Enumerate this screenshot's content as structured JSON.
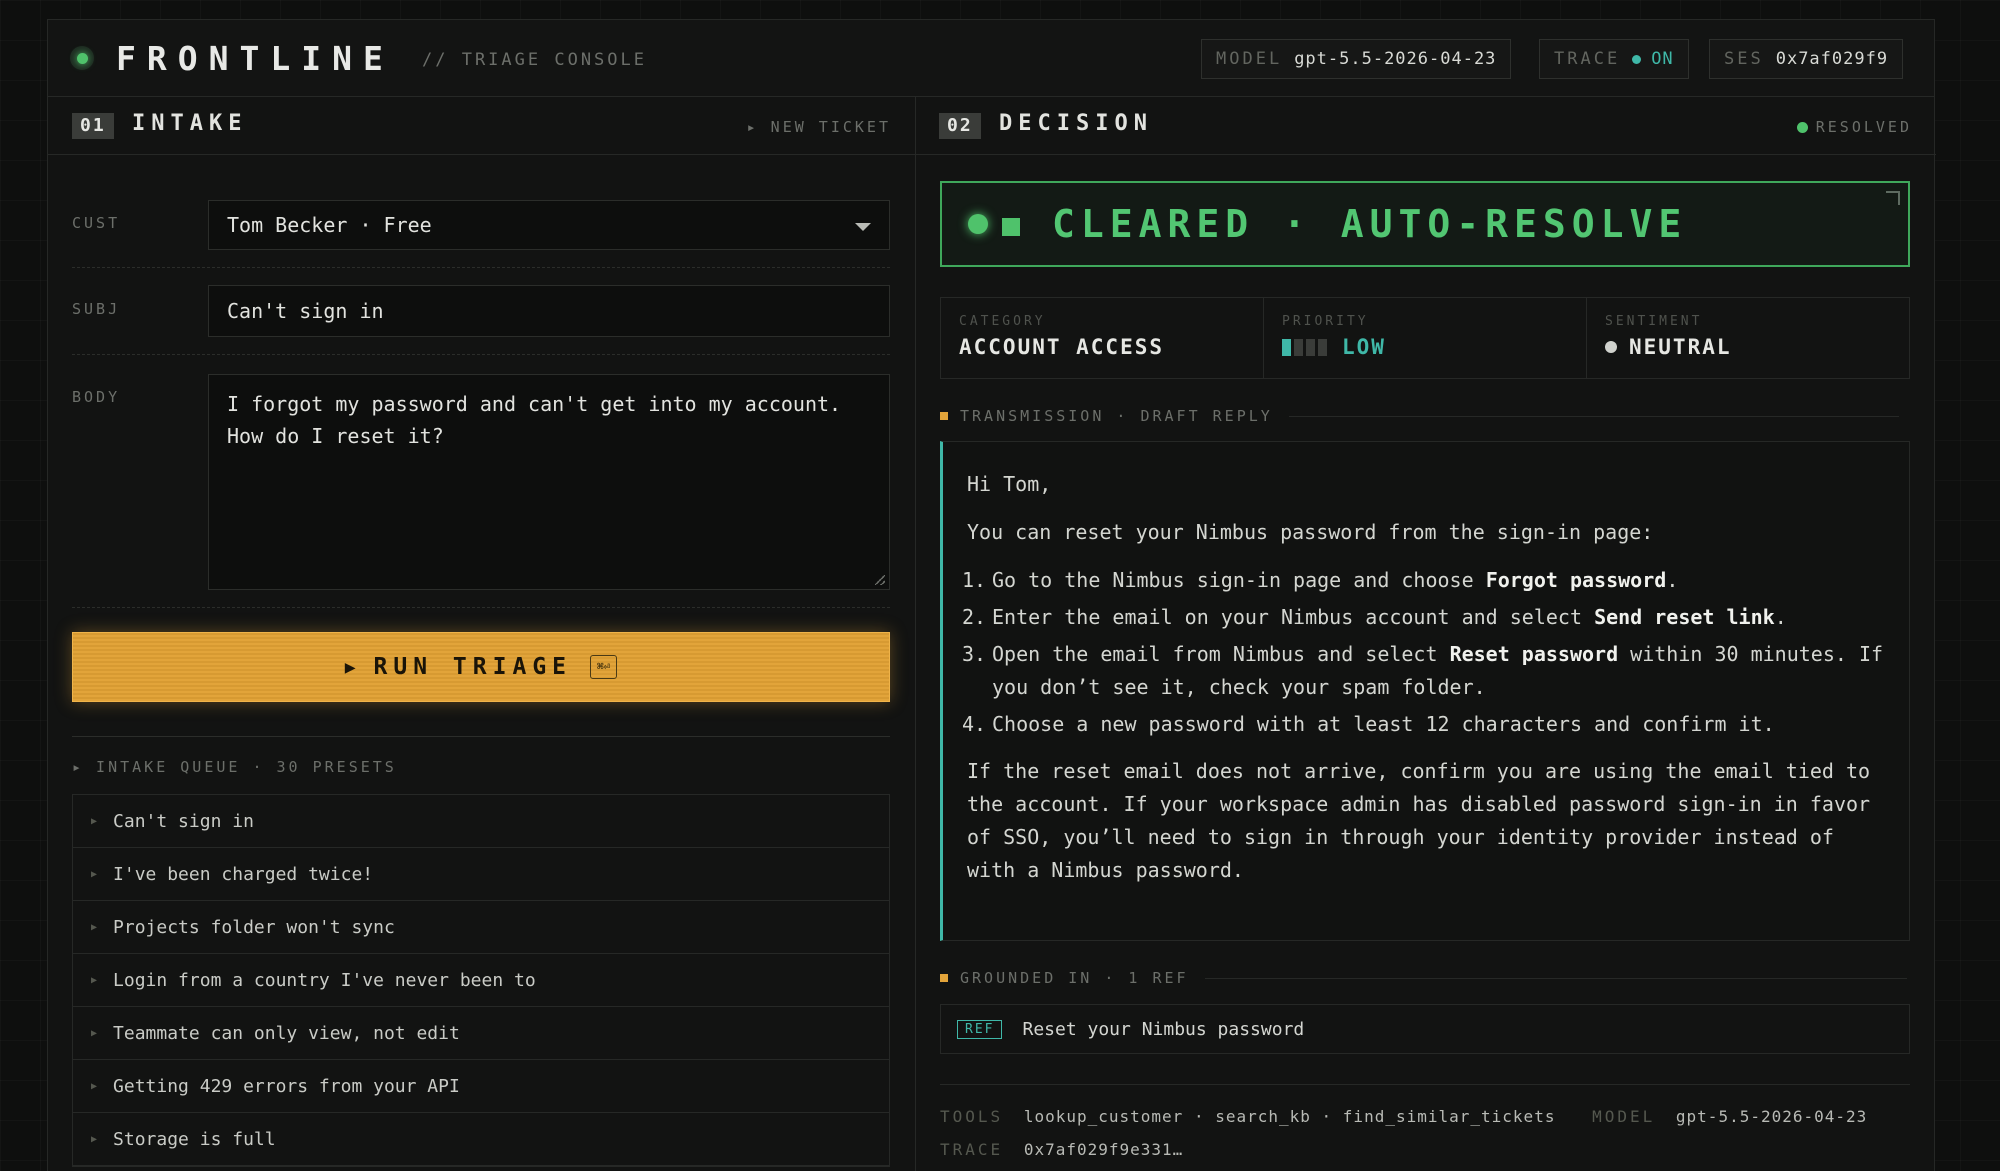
{
  "header": {
    "brand": "FRONTLINE",
    "subtitle": "// TRIAGE CONSOLE",
    "model_label": "MODEL",
    "model_value": "gpt-5.5-2026-04-23",
    "trace_label": "TRACE",
    "trace_value": "ON",
    "session_label": "SES",
    "session_value": "0x7af029f9"
  },
  "intake": {
    "number": "01",
    "title": "INTAKE",
    "action": "▸ NEW TICKET",
    "customer_label": "CUST",
    "customer_value": "Tom Becker · Free",
    "subject_label": "SUBJ",
    "subject_value": "Can't sign in",
    "body_label": "BODY",
    "body_value": "I forgot my password and can't get into my account.\nHow do I reset it?",
    "run_button": "RUN TRIAGE",
    "run_shortcut": "⌘⏎",
    "queue_header": "▸ INTAKE QUEUE · 30 PRESETS",
    "queue": [
      "Can't sign in",
      "I've been charged twice!",
      "Projects folder won't sync",
      "Login from a country I've never been to",
      "Teammate can only view, not edit",
      "Getting 429 errors from your API",
      "Storage is full"
    ]
  },
  "decision": {
    "number": "02",
    "title": "DECISION",
    "status": "RESOLVED",
    "banner": "CLEARED · AUTO-RESOLVE",
    "category_label": "CATEGORY",
    "category_value": "ACCOUNT ACCESS",
    "priority_label": "PRIORITY",
    "priority_value": "LOW",
    "priority_level": 1,
    "priority_max": 4,
    "sentiment_label": "SENTIMENT",
    "sentiment_value": "NEUTRAL",
    "reply_header": "TRANSMISSION · DRAFT REPLY",
    "reply": {
      "greeting": "Hi Tom,",
      "intro": "You can reset your Nimbus password from the sign-in page:",
      "step1_pre": "Go to the Nimbus sign-in page and choose ",
      "step1_bold": "Forgot password",
      "step1_post": ".",
      "step2_pre": "Enter the email on your Nimbus account and select ",
      "step2_bold": "Send reset link",
      "step2_post": ".",
      "step3_pre": "Open the email from Nimbus and select ",
      "step3_bold": "Reset password",
      "step3_post": " within 30 minutes. If you don’t see it, check your spam folder.",
      "step4": "Choose a new password with at least 12 characters and confirm it.",
      "outro": "If the reset email does not arrive, confirm you are using the email tied to the account. If your workspace admin has disabled password sign-in in favor of SSO, you’ll need to sign in through your identity provider instead of with a Nimbus password."
    },
    "grounded_header": "GROUNDED IN · 1 REF",
    "ref_tag": "REF",
    "ref_title": "Reset your Nimbus password",
    "tools_label": "TOOLS",
    "tools_value": "lookup_customer · search_kb · find_similar_tickets",
    "model_label": "MODEL",
    "model_value": "gpt-5.5-2026-04-23",
    "trace_label": "TRACE",
    "trace_value": "0x7af029f9e331…"
  },
  "colors": {
    "accent_amber": "#e2a43a",
    "accent_green": "#4fc26b",
    "accent_teal": "#3fb8a8",
    "background": "#0e0f0e"
  }
}
